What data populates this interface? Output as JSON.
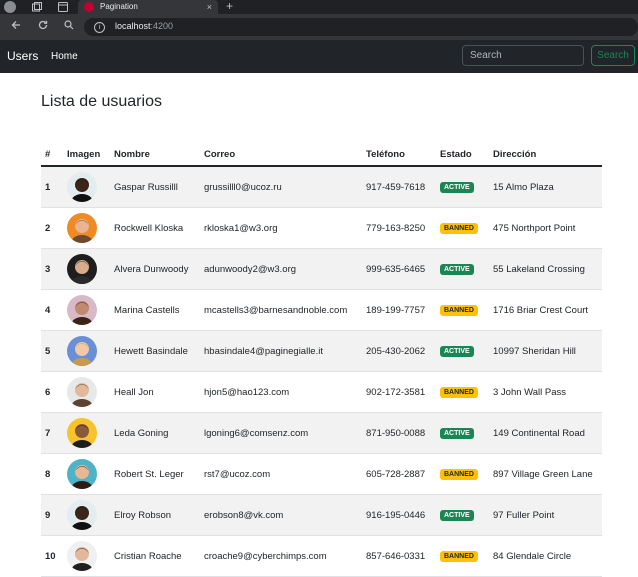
{
  "browser": {
    "tab_title": "Pagination",
    "tab_close": "×",
    "new_tab": "+",
    "url_host": "localhost",
    "url_port": ":4200"
  },
  "navbar": {
    "brand": "Users",
    "home_link": "Home",
    "search_placeholder": "Search",
    "search_button": "Search",
    "accent_color": "#198754"
  },
  "page": {
    "title": "Lista de usuarios"
  },
  "table": {
    "headers": [
      "#",
      "Imagen",
      "Nombre",
      "Correo",
      "Teléfono",
      "Estado",
      "Dirección"
    ],
    "rows": [
      {
        "num": "1",
        "name": "Gaspar Russilll",
        "email": "grussilll0@ucoz.ru",
        "phone": "917-459-7618",
        "status": "ACTIVE",
        "address": "15 Almo Plaza",
        "avatar_bg": "#e3ecef",
        "skin": "#3b2418",
        "hair": "#111111"
      },
      {
        "num": "2",
        "name": "Rockwell Kloska",
        "email": "rkloska1@w3.org",
        "phone": "779-163-8250",
        "status": "BANNED",
        "address": "475 Northport Point",
        "avatar_bg": "#f08a24",
        "skin": "#e9b48f",
        "hair": "#6b4a2f"
      },
      {
        "num": "3",
        "name": "Alvera Dunwoody",
        "email": "adunwoody2@w3.org",
        "phone": "999-635-6465",
        "status": "ACTIVE",
        "address": "55 Lakeland Crossing",
        "avatar_bg": "#1e1e1e",
        "skin": "#d8ab8b",
        "hair": "#2a2a2a"
      },
      {
        "num": "4",
        "name": "Marina Castells",
        "email": "mcastells3@barnesandnoble.com",
        "phone": "189-199-7757",
        "status": "BANNED",
        "address": "1716 Briar Crest Court",
        "avatar_bg": "#d7b9c7",
        "skin": "#c08a70",
        "hair": "#3a2418"
      },
      {
        "num": "5",
        "name": "Hewett Basindale",
        "email": "hbasindale4@paginegialle.it",
        "phone": "205-430-2062",
        "status": "ACTIVE",
        "address": "10997 Sheridan Hill",
        "avatar_bg": "#6a8fd6",
        "skin": "#f0c9a6",
        "hair": "#c89a4f"
      },
      {
        "num": "6",
        "name": "Heall Jon",
        "email": "hjon5@hao123.com",
        "phone": "902-172-3581",
        "status": "BANNED",
        "address": "3 John Wall Pass",
        "avatar_bg": "#e6e8ea",
        "skin": "#e2b89b",
        "hair": "#5c4330"
      },
      {
        "num": "7",
        "name": "Leda Goning",
        "email": "lgoning6@comsenz.com",
        "phone": "871-950-0088",
        "status": "ACTIVE",
        "address": "149 Continental Road",
        "avatar_bg": "#f6c42a",
        "skin": "#8a5a3b",
        "hair": "#1d1d1d"
      },
      {
        "num": "8",
        "name": "Robert St. Leger",
        "email": "rst7@ucoz.com",
        "phone": "605-728-2887",
        "status": "BANNED",
        "address": "897 Village Green Lane",
        "avatar_bg": "#4fb3c8",
        "skin": "#e6b896",
        "hair": "#2b1d14"
      },
      {
        "num": "9",
        "name": "Elroy Robson",
        "email": "erobson8@vk.com",
        "phone": "916-195-0446",
        "status": "ACTIVE",
        "address": "97 Fuller Point",
        "avatar_bg": "#e3ecef",
        "skin": "#3b2418",
        "hair": "#111111"
      },
      {
        "num": "10",
        "name": "Cristian Roache",
        "email": "croache9@cyberchimps.com",
        "phone": "857-646-0331",
        "status": "BANNED",
        "address": "84 Glendale Circle",
        "avatar_bg": "#eef0f2",
        "skin": "#e2b89b",
        "hair": "#1f1f1f"
      }
    ]
  },
  "status_colors": {
    "ACTIVE": "#198754",
    "BANNED": "#ffc107"
  }
}
